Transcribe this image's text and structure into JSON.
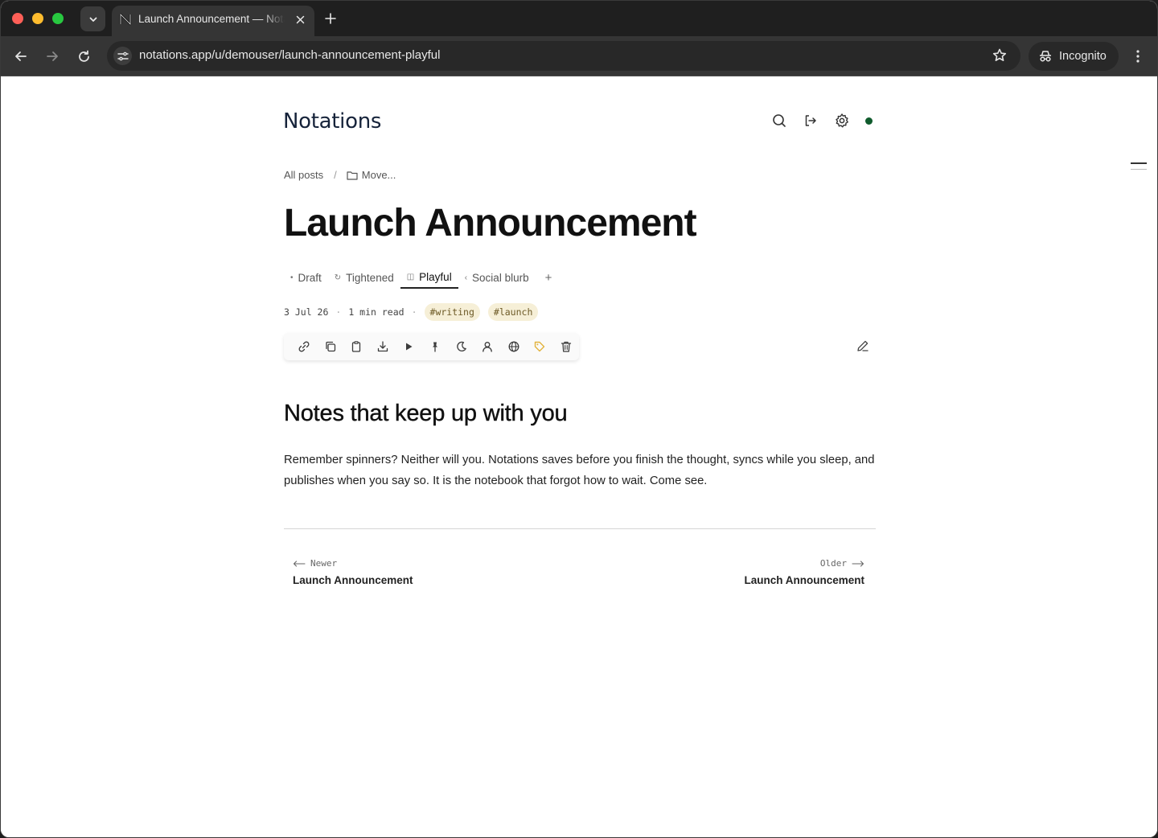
{
  "browser": {
    "tab_title": "Launch Announcement — Notations",
    "url": "notations.app/u/demouser/launch-announcement-playful",
    "incognito_label": "Incognito"
  },
  "header": {
    "logo": "Notations",
    "icons": [
      "search-icon",
      "sign-out-icon",
      "settings-gear-icon",
      "status-dot"
    ]
  },
  "breadcrumb": {
    "all_posts": "All posts",
    "separator": "/",
    "move": "Move..."
  },
  "post": {
    "title": "Launch Announcement",
    "versions": [
      {
        "label": "Draft",
        "glyph": "•"
      },
      {
        "label": "Tightened",
        "glyph": "↻"
      },
      {
        "label": "Playful",
        "glyph": "◫",
        "active": true
      },
      {
        "label": "Social blurb",
        "glyph": "‹"
      }
    ],
    "add_version": "+",
    "date": "3 Jul 26",
    "read_time": "1 min read",
    "meta_separator": "·",
    "tags": [
      "#writing",
      "#launch"
    ],
    "actions": [
      "link-icon",
      "duplicate-icon",
      "clipboard-icon",
      "download-icon",
      "play-icon",
      "pin-icon",
      "moon-icon",
      "user-icon",
      "globe-icon",
      "tag-icon",
      "trash-icon"
    ],
    "heading": "Notes that keep up with you",
    "body": "Remember spinners? Neither will you. Notations saves before you finish the thought, syncs while you sleep, and publishes when you say so. It is the notebook that forgot how to wait. Come see."
  },
  "pagination": {
    "newer_label": "Newer",
    "newer_title": "Launch Announcement",
    "older_label": "Older",
    "older_title": "Launch Announcement"
  },
  "colors": {
    "tag_bg": "#f6efd7",
    "status_dot": "#0f5b2c",
    "tag_icon_accent": "#e2b23c"
  }
}
